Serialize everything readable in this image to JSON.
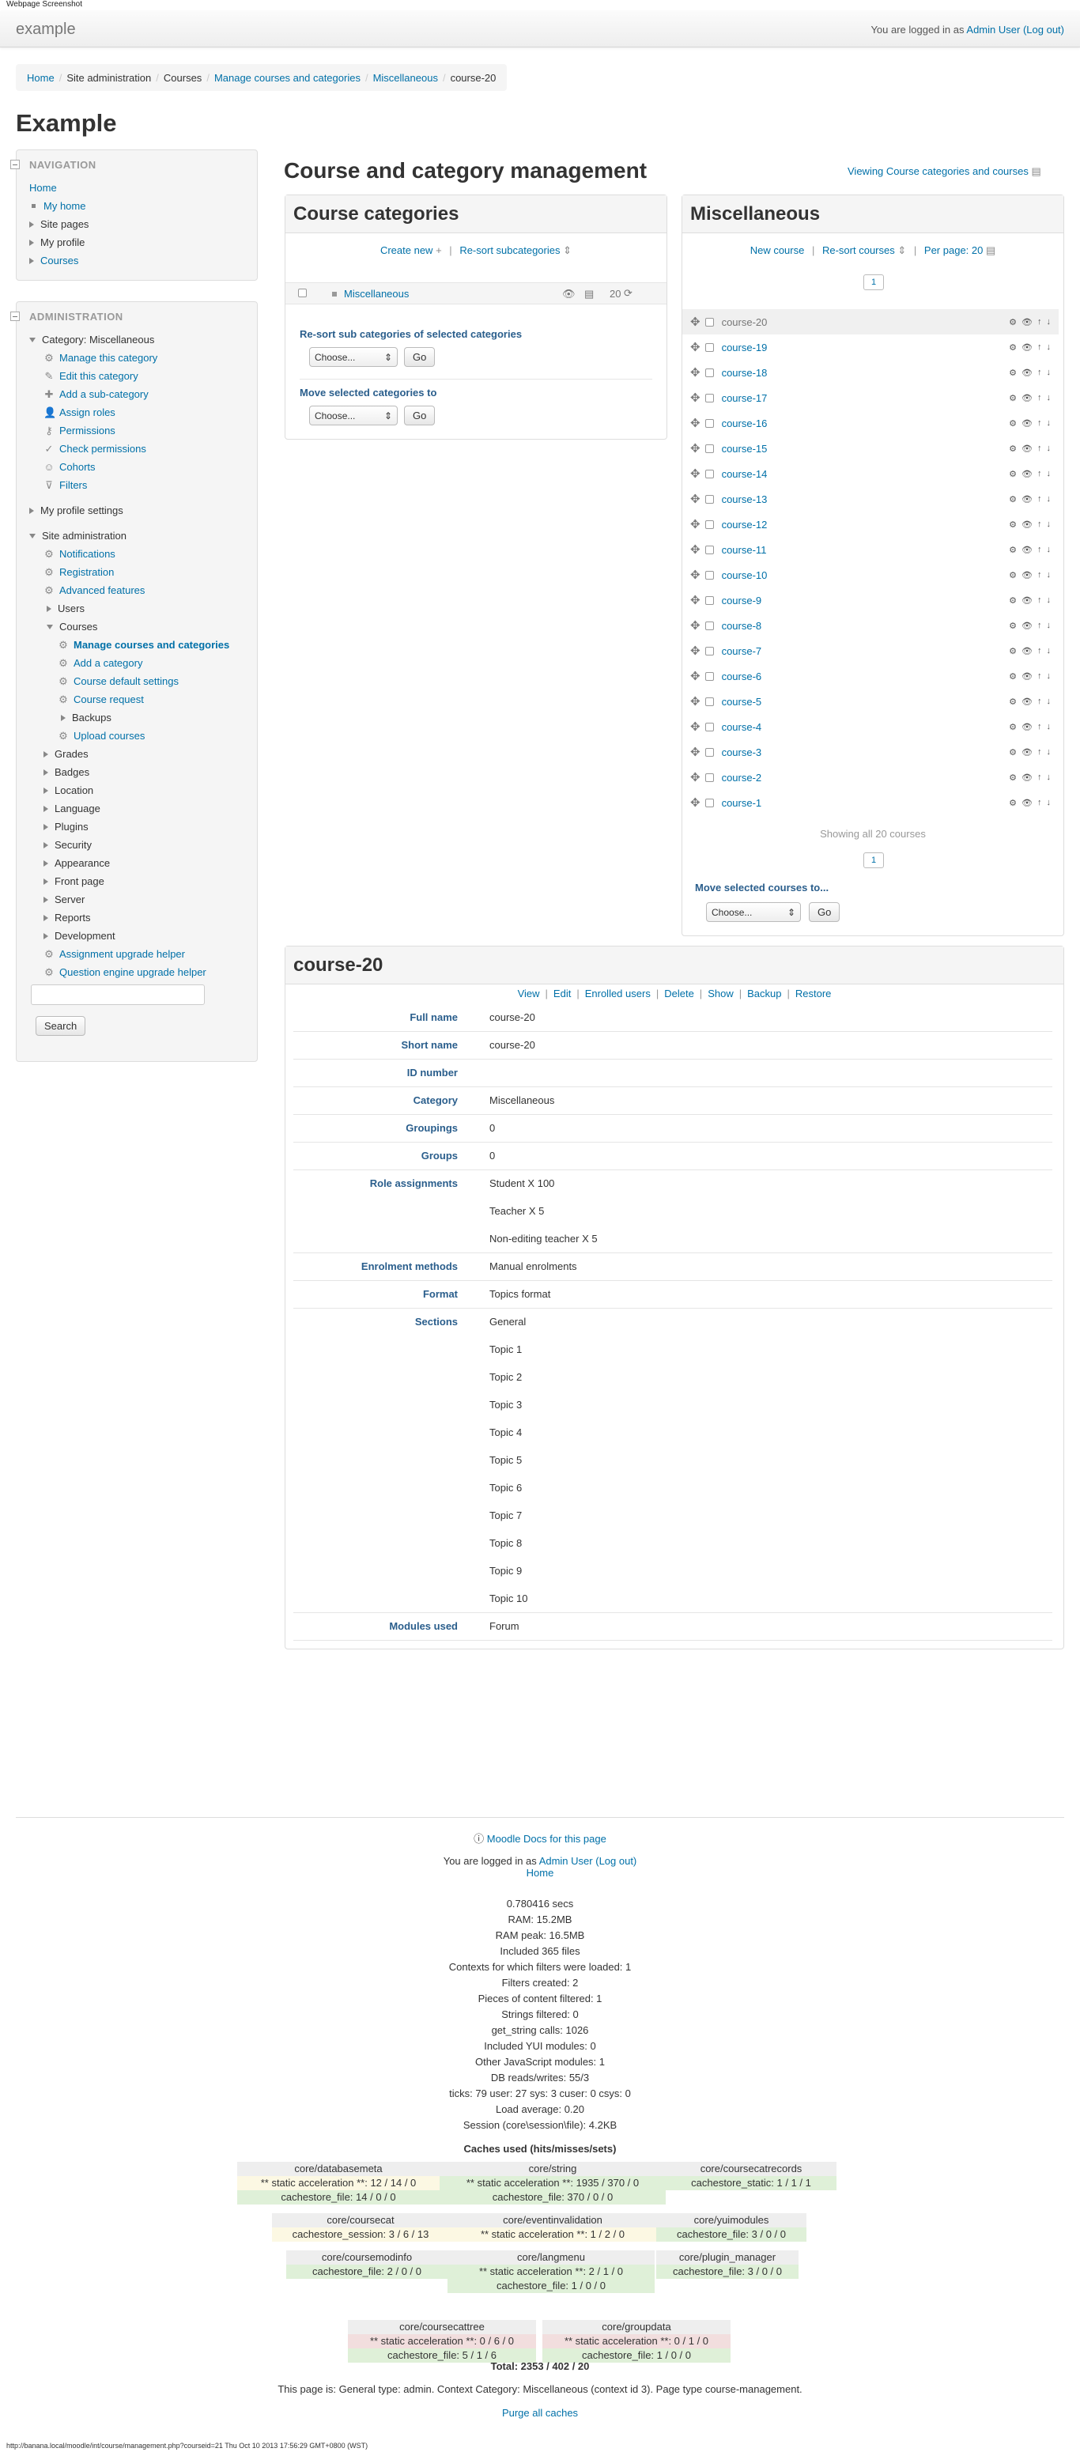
{
  "window_title": "Webpage Screenshot",
  "site": {
    "brand": "example",
    "login_prefix": "You are logged in as",
    "user": "Admin User",
    "logout": "(Log out)"
  },
  "breadcrumb": [
    "Home",
    "Site administration",
    "Courses",
    "Manage courses and categories",
    "Miscellaneous",
    "course-20"
  ],
  "page_heading": "Example",
  "navigation": {
    "title": "NAVIGATION",
    "items": [
      "Home",
      "My home",
      "Site pages",
      "My profile",
      "Courses"
    ]
  },
  "administration": {
    "title": "ADMINISTRATION",
    "category": "Category: Miscellaneous",
    "category_items": [
      "Manage this category",
      "Edit this category",
      "Add a sub-category",
      "Assign roles",
      "Permissions",
      "Check permissions",
      "Cohorts",
      "Filters"
    ],
    "profile_settings": "My profile settings",
    "site_admin": "Site administration",
    "site_items": [
      "Notifications",
      "Registration",
      "Advanced features",
      "Users",
      "Courses"
    ],
    "course_items": [
      "Manage courses and categories",
      "Add a category",
      "Course default settings",
      "Course request",
      "Backups",
      "Upload courses"
    ],
    "more_items": [
      "Grades",
      "Badges",
      "Location",
      "Language",
      "Plugins",
      "Security",
      "Appearance",
      "Front page",
      "Server",
      "Reports",
      "Development"
    ],
    "helpers": [
      "Assignment upgrade helper",
      "Question engine upgrade helper"
    ],
    "search_placeholder": "",
    "search_button": "Search"
  },
  "main": {
    "title": "Course and category management",
    "viewing": "Viewing Course categories and courses"
  },
  "categories": {
    "title": "Course categories",
    "create_new": "Create new",
    "resort": "Re-sort subcategories",
    "category_name": "Miscellaneous",
    "category_count": "20",
    "resort_selected": "Re-sort sub categories of selected categories",
    "choose": "Choose...",
    "go": "Go",
    "move_selected": "Move selected categories to"
  },
  "courses": {
    "title": "Miscellaneous",
    "new_course": "New course",
    "resort": "Re-sort courses",
    "per_page": "Per page: 20",
    "page": "1",
    "list": [
      "course-20",
      "course-19",
      "course-18",
      "course-17",
      "course-16",
      "course-15",
      "course-14",
      "course-13",
      "course-12",
      "course-11",
      "course-10",
      "course-9",
      "course-8",
      "course-7",
      "course-6",
      "course-5",
      "course-4",
      "course-3",
      "course-2",
      "course-1"
    ],
    "showing": "Showing all 20 courses",
    "move_selected": "Move selected courses to...",
    "choose": "Choose...",
    "go": "Go"
  },
  "detail": {
    "title": "course-20",
    "actions": [
      "View",
      "Edit",
      "Enrolled users",
      "Delete",
      "Show",
      "Backup",
      "Restore"
    ],
    "labels": {
      "fullname": "Full name",
      "shortname": "Short name",
      "idnumber": "ID number",
      "category": "Category",
      "groupings": "Groupings",
      "groups": "Groups",
      "roles": "Role assignments",
      "enrol": "Enrolment methods",
      "format": "Format",
      "sections": "Sections",
      "modules": "Modules used"
    },
    "values": {
      "fullname": "course-20",
      "shortname": "course-20",
      "idnumber": "",
      "category": "Miscellaneous",
      "groupings": "0",
      "groups": "0",
      "enrol": "Manual enrolments",
      "format": "Topics format",
      "modules": "Forum"
    },
    "roles": [
      "Student X 100",
      "Teacher X 5",
      "Non-editing teacher X 5"
    ],
    "sections": [
      "General",
      "Topic 1",
      "Topic 2",
      "Topic 3",
      "Topic 4",
      "Topic 5",
      "Topic 6",
      "Topic 7",
      "Topic 8",
      "Topic 9",
      "Topic 10"
    ]
  },
  "footer": {
    "docs": "Moodle Docs for this page",
    "login_prefix": "You are logged in as",
    "user": "Admin User",
    "logout": "(Log out)",
    "home": "Home",
    "perf": [
      "0.780416 secs",
      "RAM: 15.2MB",
      "RAM peak: 16.5MB",
      "Included 365 files",
      "Contexts for which filters were loaded: 1",
      "Filters created: 2",
      "Pieces of content filtered: 1",
      "Strings filtered: 0",
      "get_string calls: 1026",
      "Included YUI modules: 0",
      "Other JavaScript modules: 1",
      "DB reads/writes: 55/3",
      "ticks: 79 user: 27 sys: 3 cuser: 0 csys: 0",
      "Load average: 0.20",
      "Session (core\\session\\file): 4.2KB"
    ],
    "caches_title": "Caches used (hits/misses/sets)",
    "caches": [
      {
        "name": "core/databasemeta",
        "lines": [
          "** static acceleration **: 12 / 14 / 0",
          "cachestore_file: 14 / 0 / 0"
        ]
      },
      {
        "name": "core/string",
        "lines": [
          "** static acceleration **: 1935 / 370 / 0",
          "cachestore_file: 370 / 0 / 0"
        ]
      },
      {
        "name": "core/coursecatrecords",
        "lines": [
          "cachestore_static: 1 / 1 / 1"
        ]
      },
      {
        "name": "core/coursecat",
        "lines": [
          "cachestore_session: 3 / 6 / 13"
        ]
      },
      {
        "name": "core/eventinvalidation",
        "lines": [
          "** static acceleration **: 1 / 2 / 0"
        ]
      },
      {
        "name": "core/yuimodules",
        "lines": [
          "cachestore_file: 3 / 0 / 0"
        ]
      },
      {
        "name": "core/coursemodinfo",
        "lines": [
          "cachestore_file: 2 / 0 / 0"
        ]
      },
      {
        "name": "core/langmenu",
        "lines": [
          "** static acceleration **: 2 / 1 / 0",
          "cachestore_file: 1 / 0 / 0"
        ]
      },
      {
        "name": "core/plugin_manager",
        "lines": [
          "cachestore_file: 3 / 0 / 0"
        ]
      },
      {
        "name": "core/coursecattree",
        "lines": [
          "** static acceleration **: 0 / 6 / 0",
          "cachestore_file: 5 / 1 / 6"
        ]
      },
      {
        "name": "core/groupdata",
        "lines": [
          "** static acceleration **: 0 / 1 / 0",
          "cachestore_file: 1 / 0 / 0"
        ]
      }
    ],
    "total": "Total: 2353 / 402 / 20",
    "page_info": "This page is: General type: admin. Context Category: Miscellaneous (context id 3). Page type course-management.",
    "purge": "Purge all caches"
  },
  "status_bar": "http://banana.local/moodle/int/course/management.php?courseid=21 Thu Oct 10 2013 17:56:29 GMT+0800 (WST)"
}
